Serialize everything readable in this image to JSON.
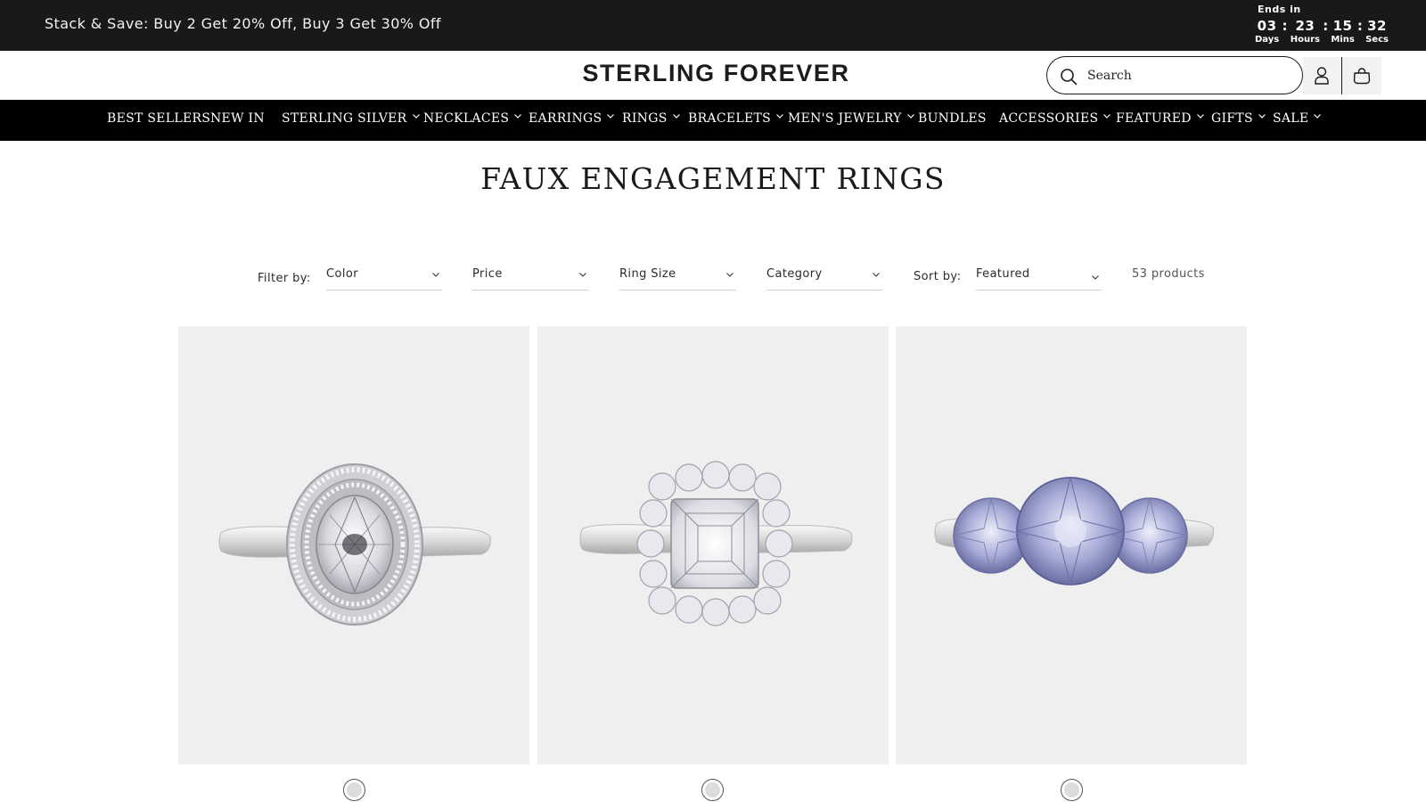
{
  "announcement": {
    "text": "Stack & Save: Buy 2 Get 20% Off, Buy 3 Get 30% Off",
    "countdown": {
      "label": "Ends in",
      "days": "03",
      "days_label": "Days",
      "hours": "23",
      "hours_label": "Hours",
      "mins": "15",
      "mins_label": "Mins",
      "secs": "32",
      "secs_label": "Secs",
      "separator": ":"
    }
  },
  "header": {
    "logo": "STERLING FOREVER",
    "search_placeholder": "Search",
    "icons": [
      "search-icon",
      "account-icon",
      "cart-icon"
    ]
  },
  "nav": {
    "items": [
      {
        "label": "BEST SELLERS",
        "has_dropdown": false
      },
      {
        "label": "NEW IN",
        "has_dropdown": false
      },
      {
        "label": "STERLING SILVER",
        "has_dropdown": true
      },
      {
        "label": "NECKLACES",
        "has_dropdown": true
      },
      {
        "label": "EARRINGS",
        "has_dropdown": true
      },
      {
        "label": "RINGS",
        "has_dropdown": true
      },
      {
        "label": "BRACELETS",
        "has_dropdown": true
      },
      {
        "label": "MEN'S JEWELRY",
        "has_dropdown": true
      },
      {
        "label": "BUNDLES",
        "has_dropdown": false
      },
      {
        "label": "ACCESSORIES",
        "has_dropdown": true
      },
      {
        "label": "FEATURED",
        "has_dropdown": true
      },
      {
        "label": "GIFTS",
        "has_dropdown": true
      },
      {
        "label": "SALE",
        "has_dropdown": true
      }
    ]
  },
  "page": {
    "title": "FAUX ENGAGEMENT RINGS"
  },
  "filters": {
    "filter_label": "Filter by:",
    "options": [
      "Color",
      "Price",
      "Ring Size",
      "Category"
    ],
    "sort_label": "Sort by:",
    "sort_value": "Featured",
    "product_count": "53 products"
  },
  "products": [
    {
      "image": "oval-halo-ring",
      "swatch": "silver"
    },
    {
      "image": "asscher-halo-ring",
      "swatch": "silver"
    },
    {
      "image": "three-stone-blue-ring",
      "swatch": "silver"
    }
  ],
  "colors": {
    "announcement_bg": "#191919",
    "nav_bg": "#000000",
    "card_bg": "#efefef"
  }
}
